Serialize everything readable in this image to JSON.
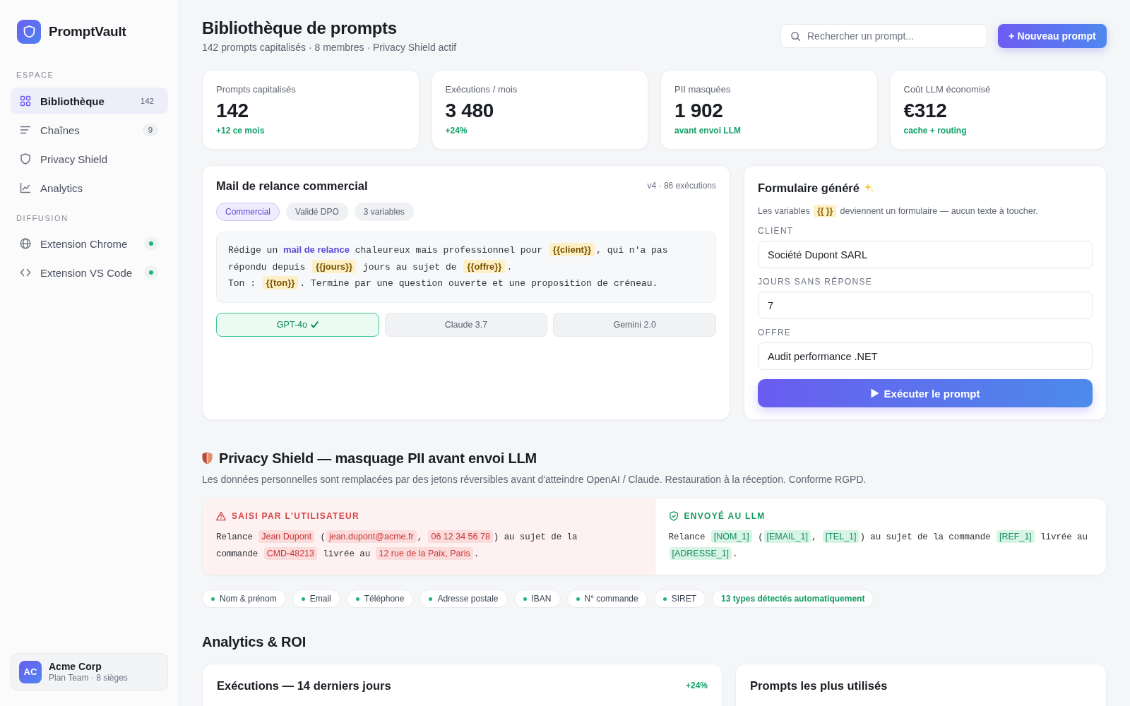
{
  "sidebar": {
    "brand": "PromptVault",
    "sections": [
      {
        "title": "ESPACE",
        "items": [
          {
            "label": "Bibliothèque",
            "count": "142",
            "selected": true
          },
          {
            "label": "Chaînes",
            "count": "9",
            "selected": false
          },
          {
            "label": "Privacy Shield",
            "selected": false
          },
          {
            "label": "Analytics",
            "selected": false
          }
        ]
      },
      {
        "title": "DIFFUSION",
        "items": [
          {
            "label": "Extension Chrome",
            "connected": true,
            "selected": false
          },
          {
            "label": "Extension VS Code",
            "connected": true,
            "selected": false
          }
        ]
      }
    ],
    "account": {
      "initials": "AC",
      "name": "Acme Corp",
      "plan": "Plan Team · 8 sièges"
    }
  },
  "header": {
    "title": "Bibliothèque de prompts",
    "subtitle": "142 prompts capitalisés · 8 membres · Privacy Shield actif",
    "search": {
      "placeholder": "Rechercher un prompt..."
    },
    "new_button": "+ Nouveau prompt"
  },
  "stats": [
    {
      "label": "Prompts capitalisés",
      "value": "142",
      "delta": "+12 ce mois"
    },
    {
      "label": "Exécutions / mois",
      "value": "3 480",
      "delta": "+24%"
    },
    {
      "label": "PII masquées",
      "value": "1 902",
      "delta": "avant envoi LLM"
    },
    {
      "label": "Coût LLM économisé",
      "value": "€312",
      "delta": "cache + routing"
    }
  ],
  "prompt_card": {
    "title": "Mail de relance commercial",
    "meta": "v4 · 86 exécutions",
    "tags": [
      {
        "label": "Commercial",
        "kind": "category"
      },
      {
        "label": "Validé DPO",
        "kind": "meta"
      },
      {
        "label": "3 variables",
        "kind": "meta"
      }
    ],
    "paragraphs": [
      [
        {
          "kind": "text",
          "text": "Rédige un "
        },
        {
          "kind": "highlight",
          "text": "mail de relance"
        },
        {
          "kind": "text",
          "text": " chaleureux mais professionnel pour "
        },
        {
          "kind": "variable",
          "text": "{{client}}"
        },
        {
          "kind": "text",
          "text": ", qui n'a pas répondu depuis "
        },
        {
          "kind": "variable",
          "text": "{{jours}}"
        },
        {
          "kind": "text",
          "text": " jours au sujet de "
        },
        {
          "kind": "variable",
          "text": "{{offre}}"
        },
        {
          "kind": "text",
          "text": "."
        }
      ],
      [
        {
          "kind": "text",
          "text": "Ton : "
        },
        {
          "kind": "variable",
          "text": "{{ton}}"
        },
        {
          "kind": "text",
          "text": ". Termine par une question ouverte et une proposition de créneau."
        }
      ]
    ],
    "models": [
      {
        "label": "GPT-4o",
        "selected": true
      },
      {
        "label": "Claude 3.7",
        "selected": false
      },
      {
        "label": "Gemini 2.0",
        "selected": false
      }
    ]
  },
  "form_card": {
    "title": "Formulaire généré",
    "description": [
      {
        "kind": "text",
        "text": "Les variables "
      },
      {
        "kind": "variable",
        "text": "{{ }}"
      },
      {
        "kind": "text",
        "text": " deviennent un formulaire — aucun texte à toucher."
      }
    ],
    "fields": [
      {
        "label": "CLIENT",
        "value": "Société Dupont SARL"
      },
      {
        "label": "JOURS SANS RÉPONSE",
        "value": "7"
      },
      {
        "label": "OFFRE",
        "value": "Audit performance .NET"
      }
    ],
    "run_button": "Exécuter le prompt"
  },
  "privacy": {
    "title": "Privacy Shield — masquage PII avant envoi LLM",
    "description": "Les données personnelles sont remplacées par des jetons réversibles avant d'atteindre OpenAI / Claude. Restauration à la réception. Conforme RGPD.",
    "panels": [
      {
        "kind": "original",
        "label": "SAISI PAR L'UTILISATEUR",
        "lines": [
          [
            {
              "kind": "text",
              "text": "Relance "
            },
            {
              "kind": "entity",
              "text": "Jean Dupont"
            },
            {
              "kind": "text",
              "text": " ("
            },
            {
              "kind": "entity",
              "text": "jean.dupont@acme.fr"
            },
            {
              "kind": "text",
              "text": ", "
            },
            {
              "kind": "entity",
              "text": "06 12 34 56 78"
            },
            {
              "kind": "text",
              "text": ") au sujet de la"
            }
          ],
          [
            {
              "kind": "text",
              "text": "commande "
            },
            {
              "kind": "entity",
              "text": "CMD-48213"
            },
            {
              "kind": "text",
              "text": " livrée au "
            },
            {
              "kind": "entity",
              "text": "12 rue de la Paix, Paris"
            },
            {
              "kind": "text",
              "text": "."
            }
          ]
        ]
      },
      {
        "kind": "masked",
        "label": "ENVOYÉ AU LLM",
        "lines": [
          [
            {
              "kind": "text",
              "text": "Relance "
            },
            {
              "kind": "entity",
              "text": "[NOM_1]"
            },
            {
              "kind": "text",
              "text": " ("
            },
            {
              "kind": "entity",
              "text": "[EMAIL_1]"
            },
            {
              "kind": "text",
              "text": ", "
            },
            {
              "kind": "entity",
              "text": "[TEL_1]"
            },
            {
              "kind": "text",
              "text": ") au sujet de la commande "
            },
            {
              "kind": "entity",
              "text": "[REF_1]"
            },
            {
              "kind": "text",
              "text": " livrée au"
            }
          ],
          [
            {
              "kind": "entity",
              "text": "[ADRESSE_1]"
            },
            {
              "kind": "text",
              "text": "."
            }
          ]
        ]
      }
    ],
    "types": [
      {
        "kind": "type",
        "label": "Nom & prénom"
      },
      {
        "kind": "type",
        "label": "Email"
      },
      {
        "kind": "type",
        "label": "Téléphone"
      },
      {
        "kind": "type",
        "label": "Adresse postale"
      },
      {
        "kind": "type",
        "label": "IBAN"
      },
      {
        "kind": "type",
        "label": "N° commande"
      },
      {
        "kind": "type",
        "label": "SIRET"
      },
      {
        "kind": "summary",
        "label": "13 types détectés automatiquement"
      }
    ]
  },
  "analytics": {
    "title": "Analytics & ROI",
    "cards": [
      {
        "title": "Exécutions — 14 derniers jours",
        "delta": "+24%"
      },
      {
        "title": "Prompts les plus utilisés"
      }
    ]
  }
}
